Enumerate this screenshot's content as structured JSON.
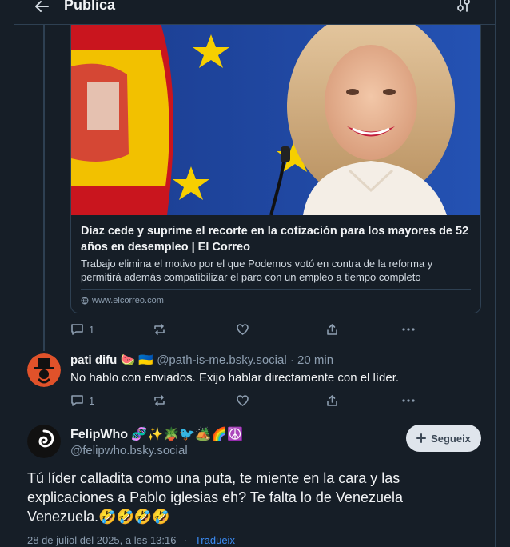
{
  "header": {
    "title": "Publica"
  },
  "embed": {
    "title": "Díaz cede y suprime el recorte en la cotización para los mayores de 52 años en desempleo | El Correo",
    "description": "Trabajo elimina el motivo por el que Podemos votó en contra de la reforma y permitirá además compatibilizar el paro con un empleo a tiempo completo",
    "domain": "www.elcorreo.com"
  },
  "parent_actions": {
    "reply_count": "1"
  },
  "reply_post": {
    "display_name": "pati difu 🍉 🇺🇦",
    "handle": "@path-is-me.bsky.social",
    "time": "· 20 min",
    "text": "No hablo con enviados. Exijo hablar directamente con el líder.",
    "reply_count": "1"
  },
  "main_post": {
    "display_name": "FelipWho 🧬✨🪴🐦🏕️🌈☮️",
    "handle": "@felipwho.bsky.social",
    "follow_label": "Segueix",
    "text": "Tú líder calladita como una puta, te miente en la cara y las explicaciones a Pablo iglesias eh? Te falta lo de Venezuela Venezuela.🤣🤣🤣🤣",
    "date": "28 de juliol del 2025, a les 13:16",
    "separator": "·",
    "translate_label": "Tradueix"
  },
  "colors": {
    "background": "#161e27",
    "border": "#2e4052",
    "muted": "#8d9eb0",
    "link": "#3b8cf5"
  }
}
